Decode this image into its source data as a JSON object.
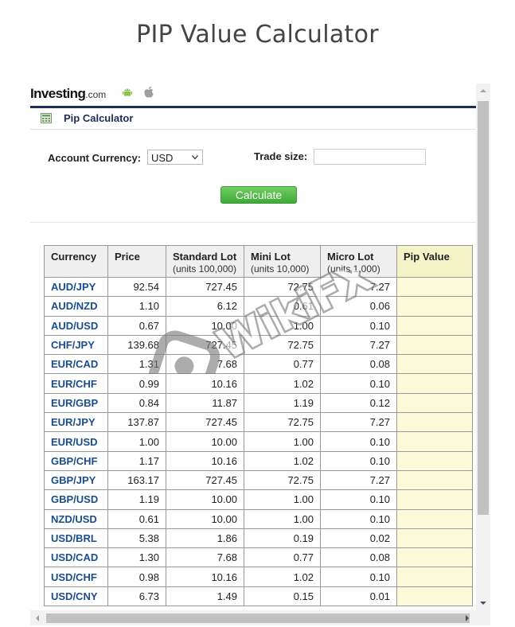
{
  "page": {
    "title": "PIP Value Calculator"
  },
  "widget": {
    "brand": {
      "name": "Investing",
      "suffix": ".com"
    },
    "header_title": "Pip Calculator",
    "form": {
      "account_currency_label": "Account Currency:",
      "account_currency_value": "USD",
      "trade_size_label": "Trade size:",
      "trade_size_value": "",
      "calculate_label": "Calculate"
    },
    "table": {
      "headers": [
        {
          "title": "Currency",
          "sub": ""
        },
        {
          "title": "Price",
          "sub": ""
        },
        {
          "title": "Standard Lot",
          "sub": "(units 100,000)"
        },
        {
          "title": "Mini Lot",
          "sub": "(units 10,000)"
        },
        {
          "title": "Micro Lot",
          "sub": "(units 1,000)"
        },
        {
          "title": "Pip Value",
          "sub": ""
        }
      ],
      "rows": [
        [
          "AUD/JPY",
          "92.54",
          "727.45",
          "72.75",
          "7.27",
          ""
        ],
        [
          "AUD/NZD",
          "1.10",
          "6.12",
          "0.61",
          "0.06",
          ""
        ],
        [
          "AUD/USD",
          "0.67",
          "10.00",
          "1.00",
          "0.10",
          ""
        ],
        [
          "CHF/JPY",
          "139.68",
          "727.45",
          "72.75",
          "7.27",
          ""
        ],
        [
          "EUR/CAD",
          "1.31",
          "7.68",
          "0.77",
          "0.08",
          ""
        ],
        [
          "EUR/CHF",
          "0.99",
          "10.16",
          "1.02",
          "0.10",
          ""
        ],
        [
          "EUR/GBP",
          "0.84",
          "11.87",
          "1.19",
          "0.12",
          ""
        ],
        [
          "EUR/JPY",
          "137.87",
          "727.45",
          "72.75",
          "7.27",
          ""
        ],
        [
          "EUR/USD",
          "1.00",
          "10.00",
          "1.00",
          "0.10",
          ""
        ],
        [
          "GBP/CHF",
          "1.17",
          "10.16",
          "1.02",
          "0.10",
          ""
        ],
        [
          "GBP/JPY",
          "163.17",
          "727.45",
          "72.75",
          "7.27",
          ""
        ],
        [
          "GBP/USD",
          "1.19",
          "10.00",
          "1.00",
          "0.10",
          ""
        ],
        [
          "NZD/USD",
          "0.61",
          "10.00",
          "1.00",
          "0.10",
          ""
        ],
        [
          "USD/BRL",
          "5.38",
          "1.86",
          "0.19",
          "0.02",
          ""
        ],
        [
          "USD/CAD",
          "1.30",
          "7.68",
          "0.77",
          "0.08",
          ""
        ],
        [
          "USD/CHF",
          "0.98",
          "10.16",
          "1.02",
          "0.10",
          ""
        ],
        [
          "USD/CNY",
          "6.73",
          "1.49",
          "0.15",
          "0.01",
          ""
        ]
      ]
    }
  },
  "watermark": {
    "text": "WikiFX"
  },
  "icons": [
    "android-icon",
    "apple-icon",
    "calculator-icon",
    "chevron-down-icon",
    "scroll-up-icon",
    "scroll-down-icon",
    "scroll-left-icon",
    "scroll-right-icon"
  ],
  "colors": {
    "brand_navy": "#1c2d57",
    "currency_link": "#1a4d8e",
    "button_green": "#4cb944",
    "pip_column": "#fbfbd9"
  }
}
